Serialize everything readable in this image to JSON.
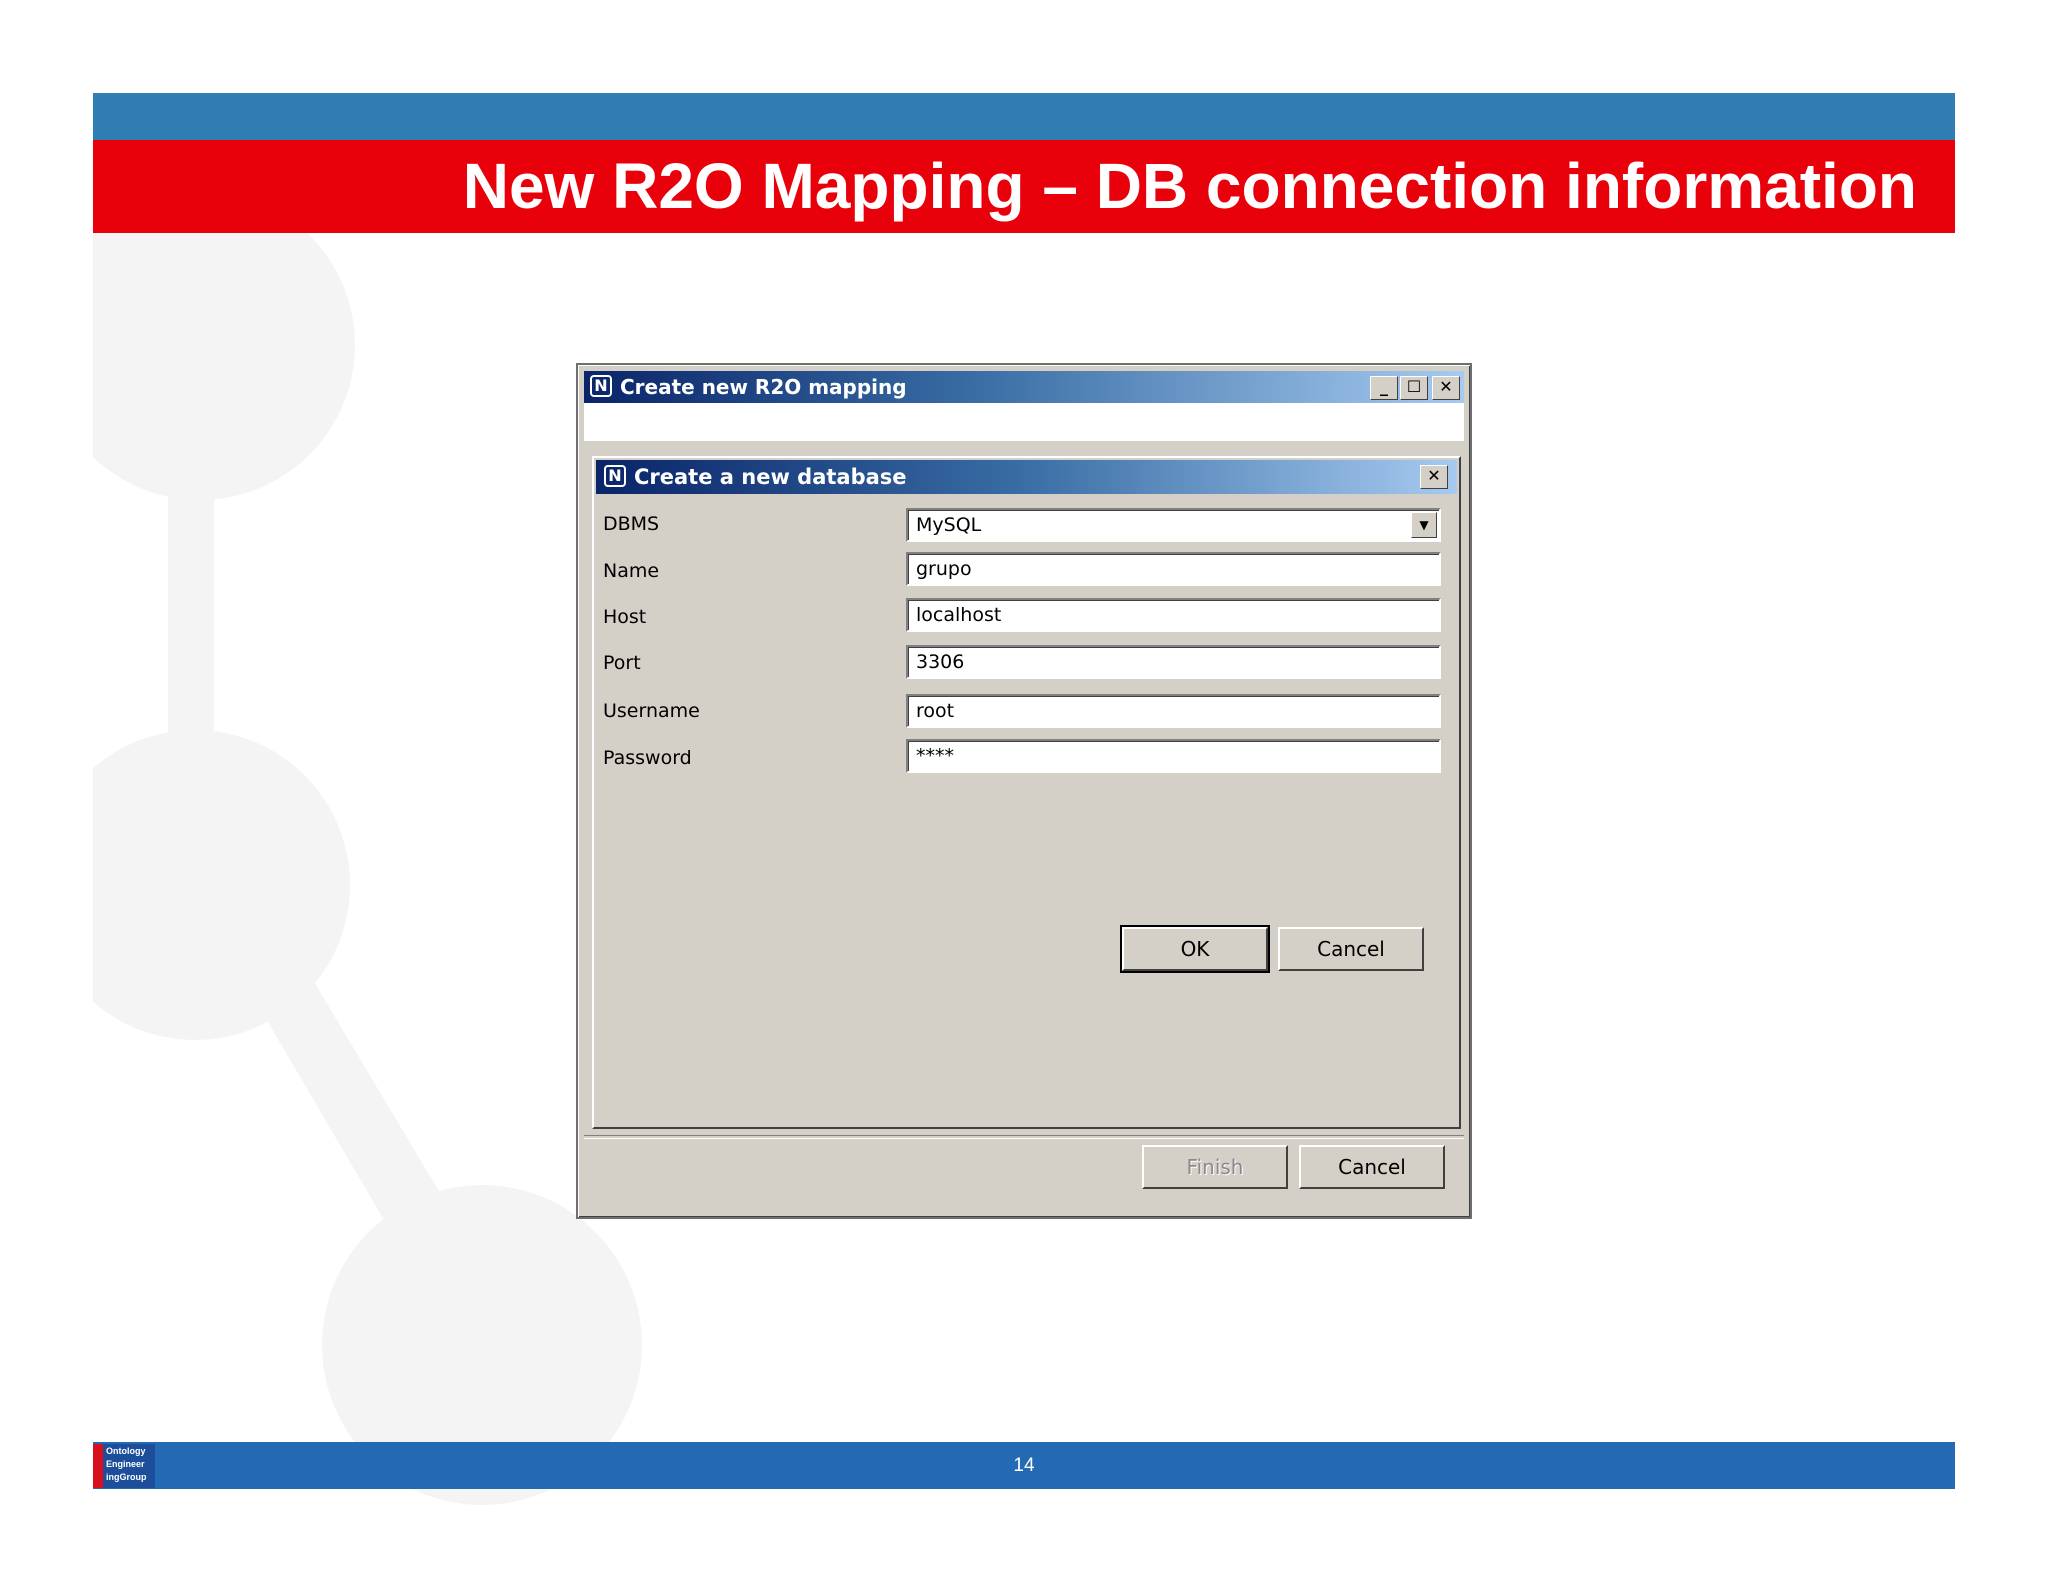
{
  "slide": {
    "title": "New R2O Mapping – DB connection information",
    "page_number": "14",
    "logo_text": "Ontology\nEngineer\ningGroup"
  },
  "outer_window": {
    "title": "Create new R2O mapping",
    "minimize_glyph": "_",
    "maximize_glyph": "☐",
    "close_glyph": "✕",
    "finish_label": "Finish",
    "cancel_label": "Cancel"
  },
  "dialog": {
    "title": "Create a new database",
    "close_glyph": "✕",
    "app_icon_glyph": "N",
    "fields": {
      "dbms": {
        "label": "DBMS",
        "value": "MySQL"
      },
      "name": {
        "label": "Name",
        "value": "grupo"
      },
      "host": {
        "label": "Host",
        "value": "localhost"
      },
      "port": {
        "label": "Port",
        "value": "3306"
      },
      "username": {
        "label": "Username",
        "value": "root"
      },
      "password": {
        "label": "Password",
        "value": "****"
      }
    },
    "ok_label": "OK",
    "cancel_label": "Cancel"
  },
  "colors": {
    "header_red": "#e8000b",
    "header_blue": "#2f7db3",
    "footer_blue": "#2469b4",
    "window_face": "#d4d0c8",
    "titlebar_dark": "#0a246a"
  }
}
